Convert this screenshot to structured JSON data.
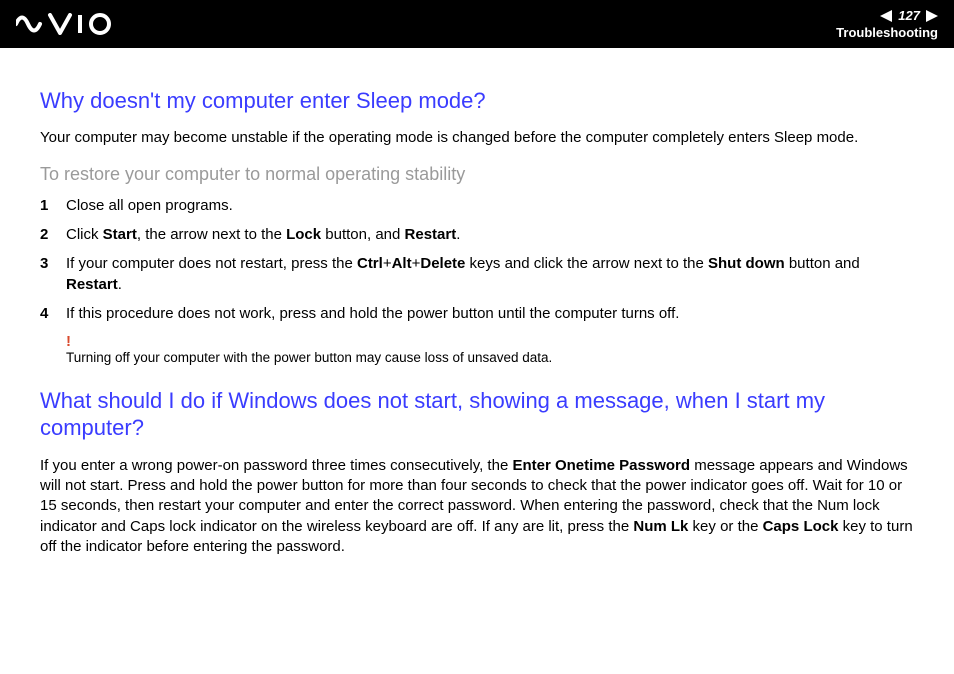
{
  "header": {
    "page_number": "127",
    "section": "Troubleshooting"
  },
  "section1": {
    "title": "Why doesn't my computer enter Sleep mode?",
    "intro": "Your computer may become unstable if the operating mode is changed before the computer completely enters Sleep mode.",
    "subtitle": "To restore your computer to normal operating stability",
    "steps": {
      "s1": "Close all open programs.",
      "s2_a": "Click ",
      "s2_b_bold": "Start",
      "s2_c": ", the arrow next to the ",
      "s2_d_bold": "Lock",
      "s2_e": " button, and ",
      "s2_f_bold": "Restart",
      "s2_g": ".",
      "s3_a": "If your computer does not restart, press the ",
      "s3_b_bold": "Ctrl",
      "s3_c": "+",
      "s3_d_bold": "Alt",
      "s3_e": "+",
      "s3_f_bold": "Delete",
      "s3_g": " keys and click the arrow next to the ",
      "s3_h_bold": "Shut down",
      "s3_i": " button and ",
      "s3_j_bold": "Restart",
      "s3_k": ".",
      "s4": "If this procedure does not work, press and hold the power button until the computer turns off."
    },
    "warning_mark": "!",
    "warning_text": "Turning off your computer with the power button may cause loss of unsaved data."
  },
  "section2": {
    "title": "What should I do if Windows does not start, showing a message, when I start my computer?",
    "p_a": "If you enter a wrong power-on password three times consecutively, the ",
    "p_b_bold": "Enter Onetime Password",
    "p_c": " message appears and Windows will not start. Press and hold the power button for more than four seconds to check that the power indicator goes off. Wait for 10 or 15 seconds, then restart your computer and enter the correct password. When entering the password, check that the Num lock indicator and Caps lock indicator on the wireless keyboard are off. If any are lit, press the ",
    "p_d_bold": "Num Lk",
    "p_e": " key or the ",
    "p_f_bold": "Caps Lock",
    "p_g": " key to turn off the indicator before entering the password."
  }
}
